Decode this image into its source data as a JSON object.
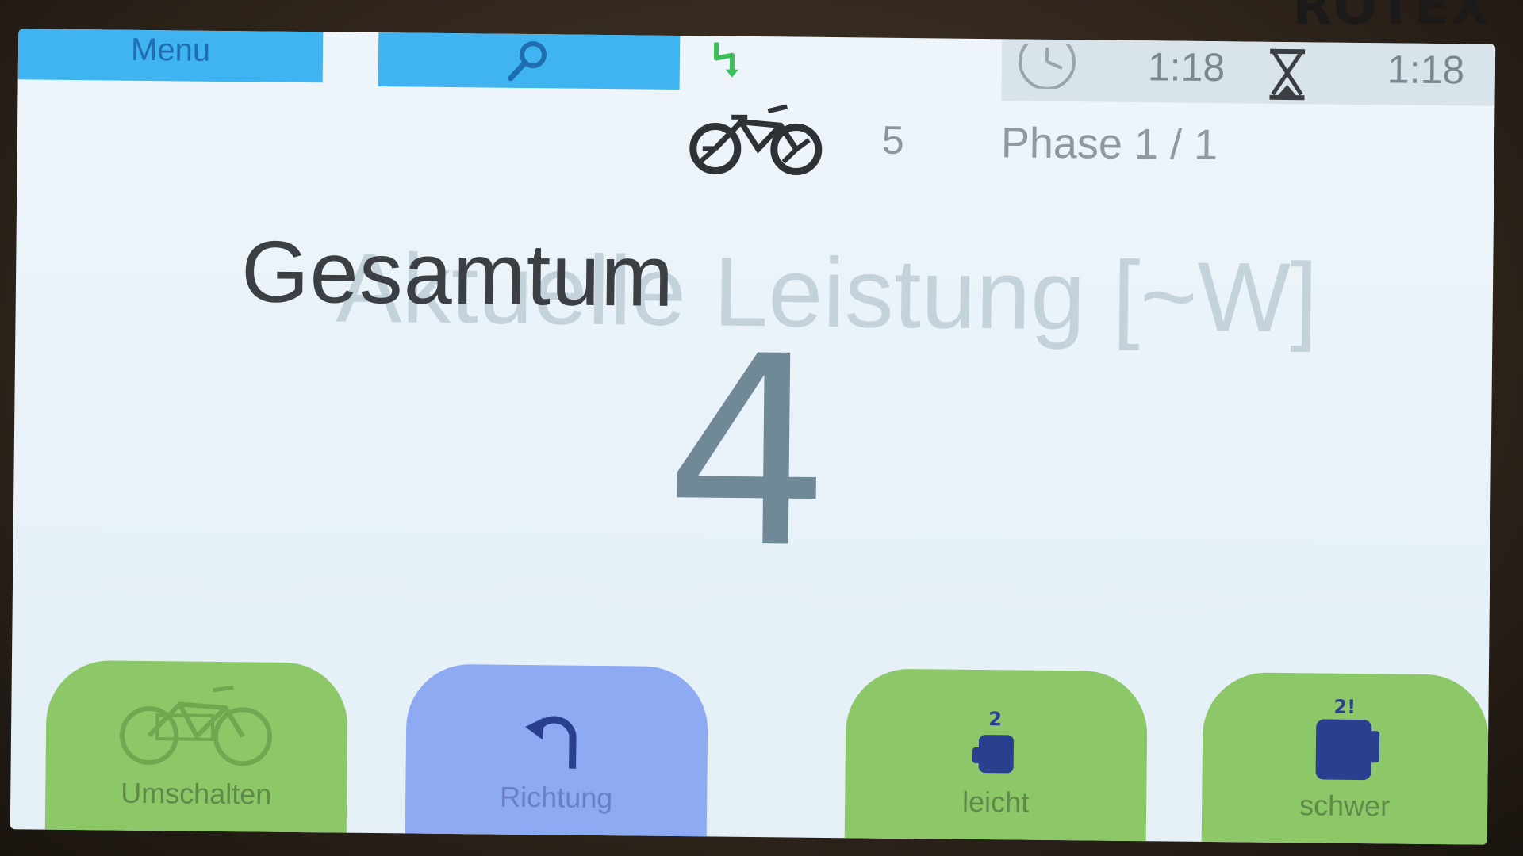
{
  "device": {
    "brand": "ROTEX"
  },
  "topbar": {
    "menu_label": "Menu",
    "search_icon": "magnifier-icon",
    "status_icon": "lightning-icon",
    "clock_icon": "clock-icon",
    "time_elapsed": "1:18",
    "hourglass_icon": "hourglass-icon",
    "time_remaining": "1:18"
  },
  "status_row": {
    "bike_icon": "bicycle-icon",
    "bike_count": "5",
    "phase": "Phase 1 / 1"
  },
  "main": {
    "title": "Gesamtum",
    "title_ghost": "Aktuelle Leistung [~W]",
    "value": "4"
  },
  "bottom_buttons": [
    {
      "icon": "bicycle-icon",
      "label": "Umschalten",
      "color": "#8cc768"
    },
    {
      "icon": "undo-arrow-icon",
      "label": "Richtung",
      "color": "#8eaaf2"
    },
    {
      "icon": "weight-light-icon",
      "label": "leicht",
      "color": "#8cc768"
    },
    {
      "icon": "weight-heavy-icon",
      "label": "schwer",
      "color": "#8cc768"
    }
  ],
  "colors": {
    "accent_blue": "#3fb4f0",
    "screen_bg": "#eef5fa",
    "value_color": "#6f8996"
  }
}
